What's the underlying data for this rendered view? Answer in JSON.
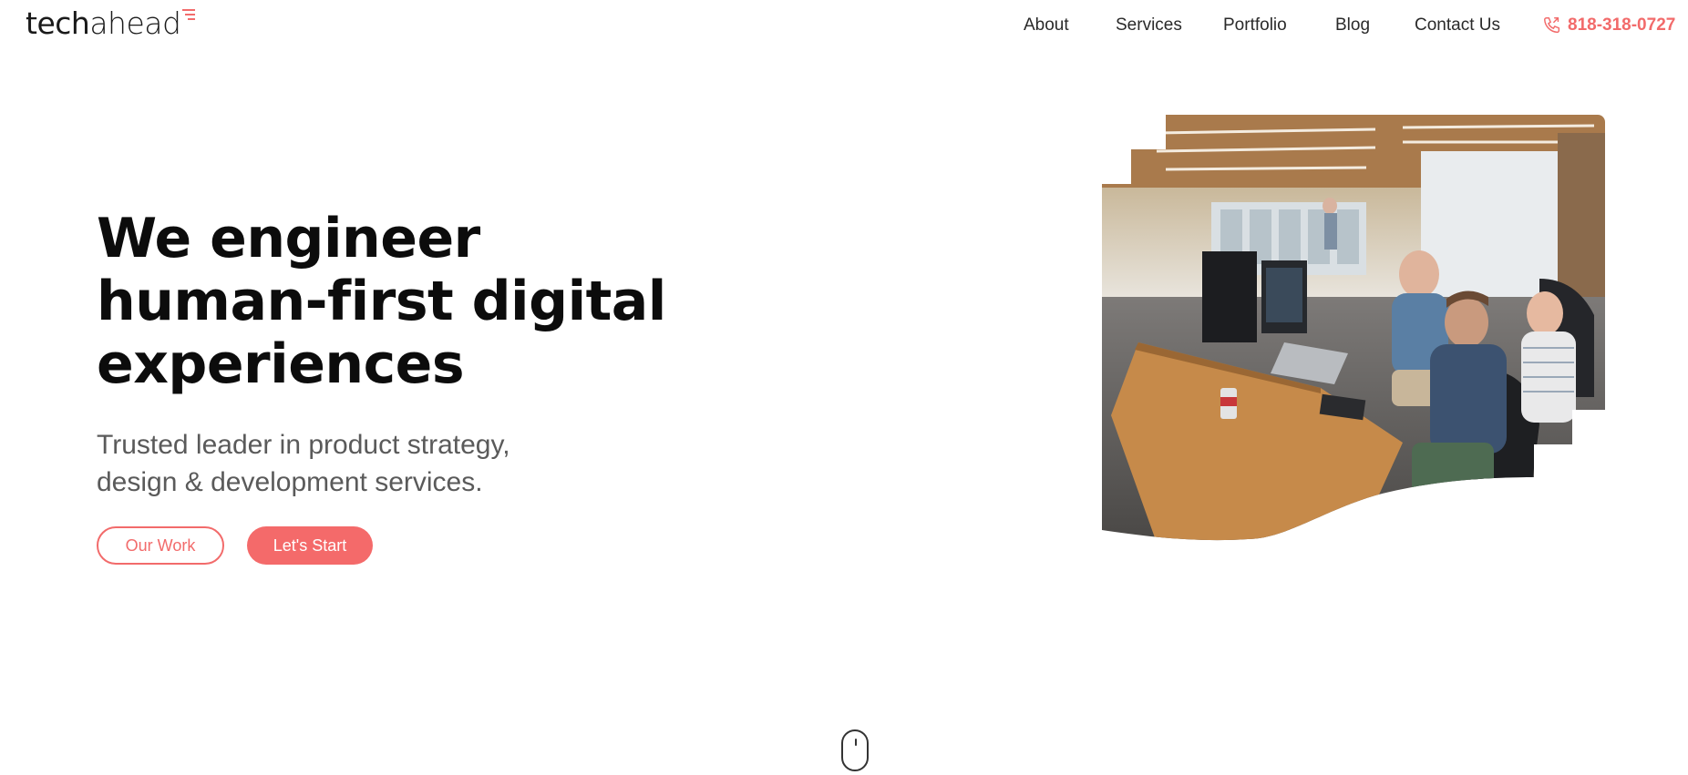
{
  "header": {
    "logo": {
      "part1": "tech",
      "part2": "ahead"
    },
    "nav": [
      {
        "label": "About"
      },
      {
        "label": "Services"
      },
      {
        "label": "Portfolio"
      },
      {
        "label": "Blog"
      },
      {
        "label": "Contact Us"
      }
    ],
    "phone": {
      "number": "818-318-0727",
      "icon": "phone-icon"
    }
  },
  "hero": {
    "title_line1": "We engineer",
    "title_line2": "human-first digital",
    "title_line3": "experiences",
    "subtitle_line1": "Trusted leader in product strategy,",
    "subtitle_line2": "design & development services.",
    "buttons": {
      "primary_outline": "Our Work",
      "primary_fill": "Let's Start"
    }
  },
  "colors": {
    "accent": "#f26b6b",
    "text": "#0c0c0c",
    "muted": "#5a5a5a"
  },
  "icons": [
    "phone-icon",
    "scroll-mouse-icon"
  ]
}
